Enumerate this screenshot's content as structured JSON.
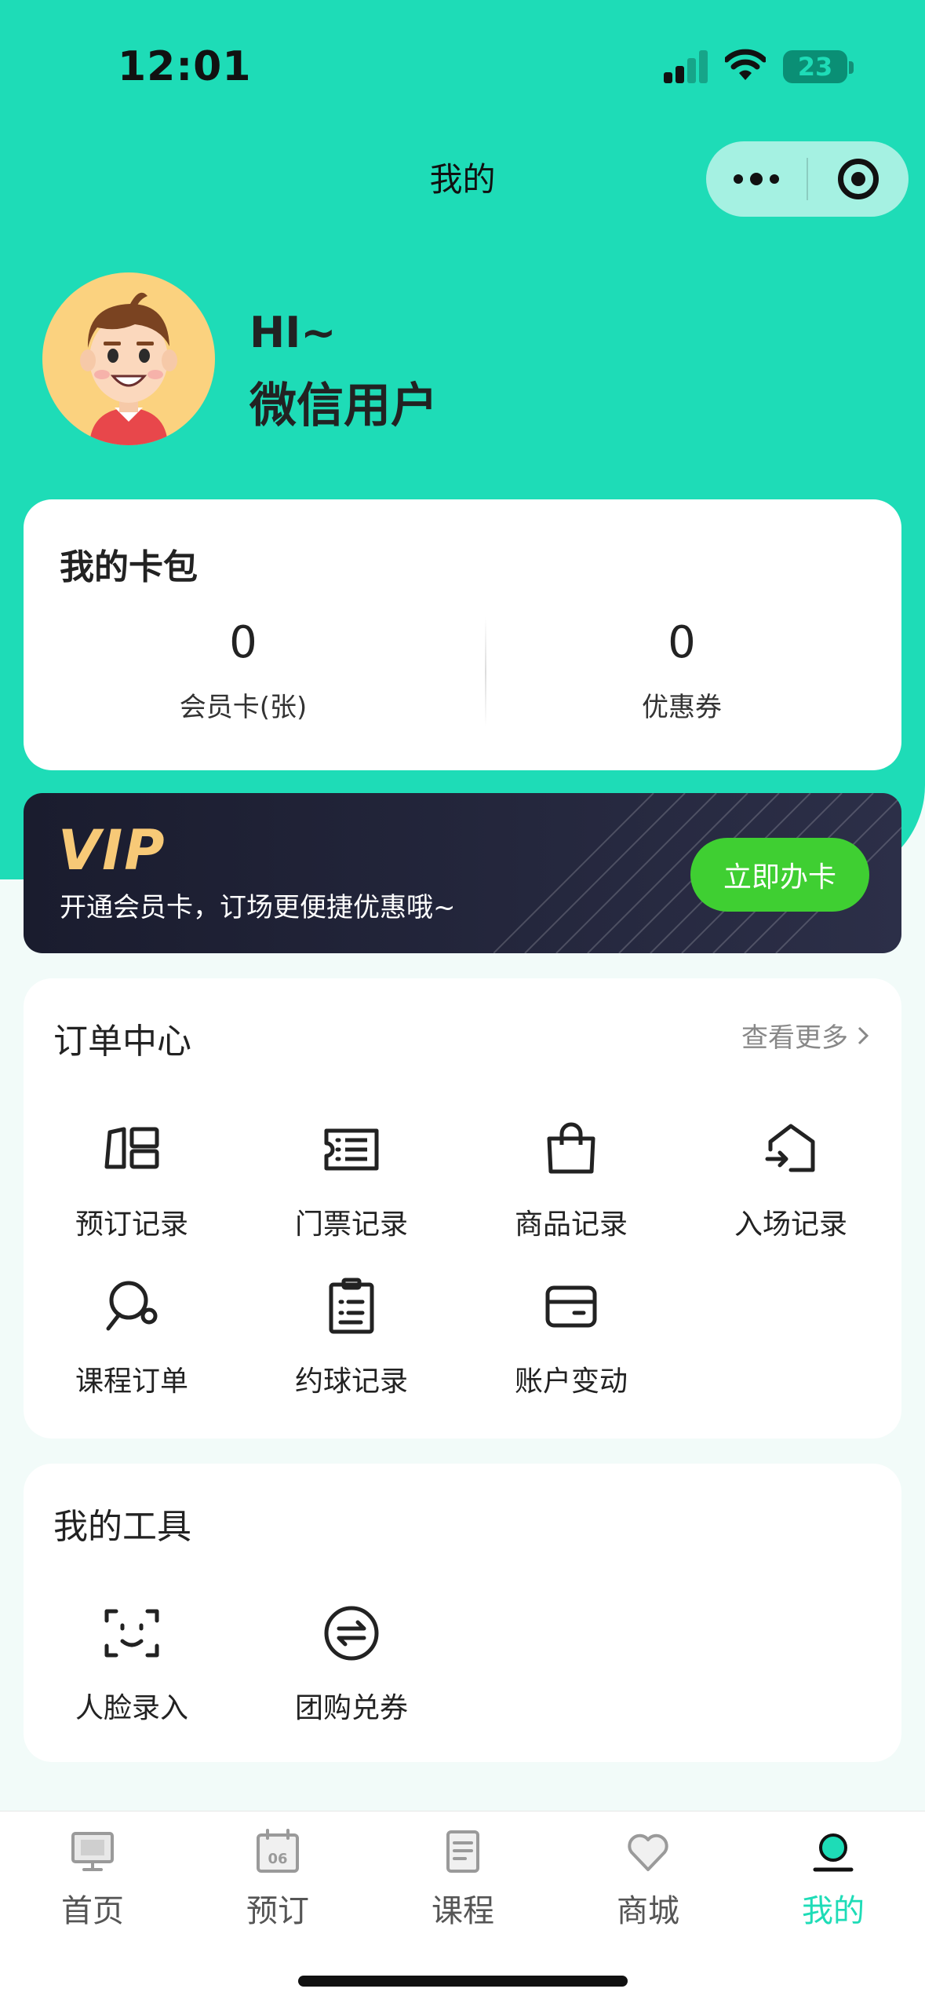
{
  "status_bar": {
    "time": "12:01",
    "battery": "23"
  },
  "nav": {
    "title": "我的"
  },
  "profile": {
    "greeting": "HI~",
    "name": "微信用户"
  },
  "wallet": {
    "title": "我的卡包",
    "member_cards": {
      "value": "0",
      "label": "会员卡(张)"
    },
    "coupons": {
      "value": "0",
      "label": "优惠券"
    }
  },
  "vip": {
    "logo": "VIP",
    "subtitle": "开通会员卡，订场更便捷优惠哦~",
    "button": "立即办卡"
  },
  "orders": {
    "title": "订单中心",
    "more": "查看更多",
    "items": [
      {
        "label": "预订记录",
        "icon": "booking-icon"
      },
      {
        "label": "门票记录",
        "icon": "ticket-icon"
      },
      {
        "label": "商品记录",
        "icon": "shopping-bag-icon"
      },
      {
        "label": "入场记录",
        "icon": "entry-icon"
      },
      {
        "label": "课程订单",
        "icon": "ping-pong-icon"
      },
      {
        "label": "约球记录",
        "icon": "clipboard-icon"
      },
      {
        "label": "账户变动",
        "icon": "wallet-card-icon"
      }
    ]
  },
  "tools": {
    "title": "我的工具",
    "items": [
      {
        "label": "人脸录入",
        "icon": "face-scan-icon"
      },
      {
        "label": "团购兑券",
        "icon": "exchange-icon"
      }
    ]
  },
  "tabbar": {
    "items": [
      {
        "label": "首页",
        "icon": "monitor-icon"
      },
      {
        "label": "预订",
        "icon": "calendar-icon",
        "calendar_day": "06"
      },
      {
        "label": "课程",
        "icon": "document-icon"
      },
      {
        "label": "商城",
        "icon": "heart-icon"
      },
      {
        "label": "我的",
        "icon": "profile-icon",
        "active": true
      }
    ]
  },
  "colors": {
    "accent": "#1edcb7",
    "vip_button": "#3fcf32",
    "vip_gold": "#f7c977"
  }
}
